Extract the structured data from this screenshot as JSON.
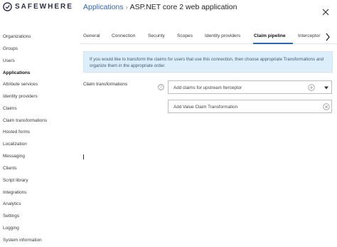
{
  "header": {
    "brand": "SAFEWHERE",
    "breadcrumb_parent": "Applications",
    "breadcrumb_sep": "›",
    "breadcrumb_current": "ASP.NET core 2 web application"
  },
  "sidebar": {
    "items": [
      {
        "label": "Organizations"
      },
      {
        "label": "Groups"
      },
      {
        "label": "Users"
      },
      {
        "label": "Applications",
        "active": true
      },
      {
        "label": "Attribute services"
      },
      {
        "label": "Identity providers"
      },
      {
        "label": "Claims"
      },
      {
        "label": "Claim transformations"
      },
      {
        "label": "Hosted forms"
      },
      {
        "label": "Localization"
      },
      {
        "label": "Messaging"
      },
      {
        "label": "Clients"
      },
      {
        "label": "Script library"
      },
      {
        "label": "Integrations"
      },
      {
        "label": "Analytics"
      },
      {
        "label": "Settings"
      },
      {
        "label": "Logging"
      },
      {
        "label": "System information"
      }
    ]
  },
  "tabs": [
    {
      "label": "General"
    },
    {
      "label": "Connection"
    },
    {
      "label": "Security"
    },
    {
      "label": "Scopes"
    },
    {
      "label": "Identity providers"
    },
    {
      "label": "Claim pipeline",
      "active": true
    },
    {
      "label": "Interceptor"
    }
  ],
  "info_text": "If you would like to transform the claims for users that use this connection, then choose appropriate Transformations and organize them in the appropriate order.",
  "claim_transformations": {
    "label": "Claim transformations",
    "select_value": "Add claims for upstream Iterceptor",
    "add_value": "Add Value Claim Transformation"
  },
  "colors": {
    "accent": "#2f64b4",
    "info_bg": "#ddeefb",
    "brand": "#2b2f4a"
  }
}
